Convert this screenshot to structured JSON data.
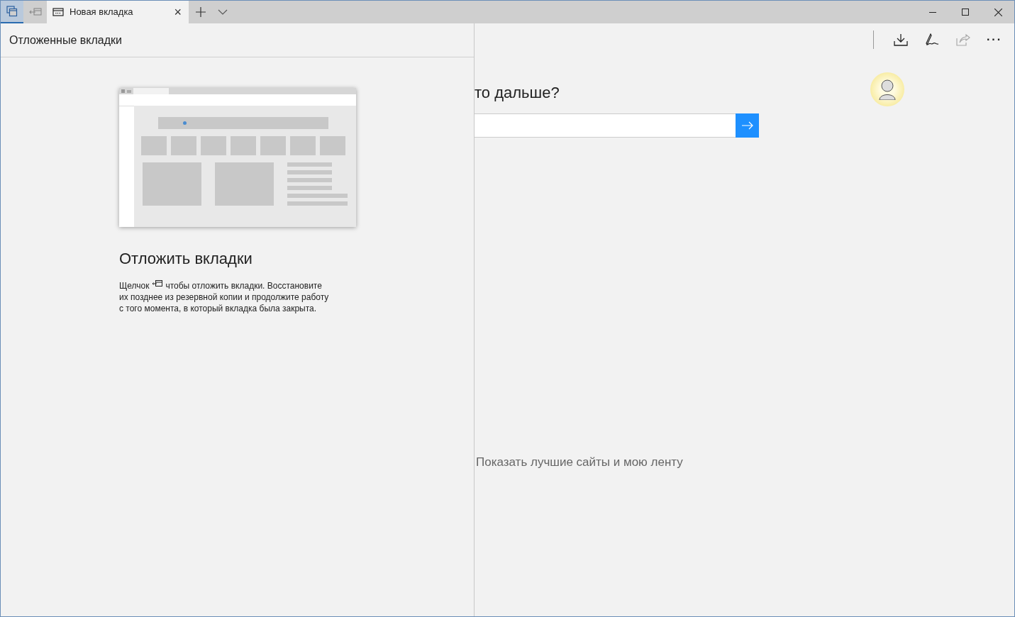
{
  "tab_bar": {
    "tab_manager_selected": true,
    "tab": {
      "title": "Новая вкладка",
      "close": "×"
    }
  },
  "panel": {
    "title": "Отложенные вкладки",
    "heading": "Отложить вкладки",
    "text_before_icon": "Щелчок",
    "text_after_icon": "чтобы отложить вкладки. Восстановите",
    "text_continued": "их позднее из резервной копии и продолжите работу с того момента, в который вкладка была закрыта."
  },
  "toolbar": {
    "share_disabled": true,
    "more": "···"
  },
  "new_tab_page": {
    "heading": "то дальше?",
    "show_feed_link": "Показать лучшие сайты и мою ленту"
  }
}
